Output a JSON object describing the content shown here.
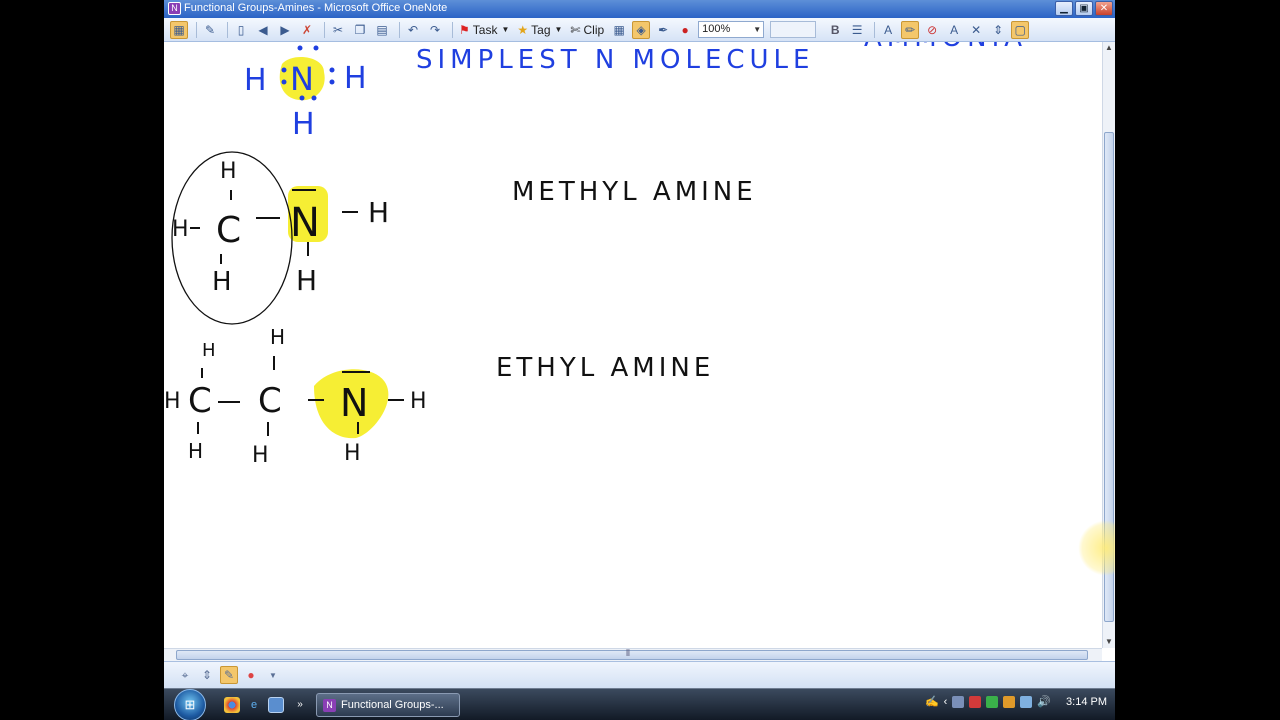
{
  "window": {
    "title": "Functional Groups-Amines - Microsoft Office OneNote",
    "app_icon": "onenote-icon",
    "buttons": [
      "minimize",
      "maximize",
      "close"
    ]
  },
  "toolbar": {
    "task_label": "Task",
    "tag_label": "Tag",
    "clip_label": "Clip",
    "zoom": "100%",
    "bold_label": "B"
  },
  "notes": {
    "heading_line": "SIMPLEST N MOLECULE",
    "heading_trail": "AMMONIA",
    "ammonia": {
      "n": "N",
      "h_left": "H",
      "h_right": "H",
      "h_bottom": "H"
    },
    "methyl": {
      "label": "METHYL AMINE",
      "c": "C",
      "n": "N",
      "h_top": "H",
      "h_left": "H",
      "h_bottom": "H",
      "h_n_right": "H",
      "h_n_bottom": "H"
    },
    "ethyl": {
      "label": "ETHYL AMINE",
      "c1": "C",
      "c2": "C",
      "n": "N",
      "h_c1_top": "H",
      "h_c1_left": "H",
      "h_c1_bottom": "H",
      "h_c2_top": "H",
      "h_c2_bottom": "H",
      "h_n_right": "H",
      "h_n_bottom": "H"
    }
  },
  "taskbar": {
    "task_button": "Functional Groups-...",
    "clock": "3:14 PM"
  },
  "colors": {
    "ink_blue": "#1f3fe0",
    "ink_black": "#111111",
    "highlight": "#f5ec1e",
    "titlebar": "#2b63c6"
  }
}
